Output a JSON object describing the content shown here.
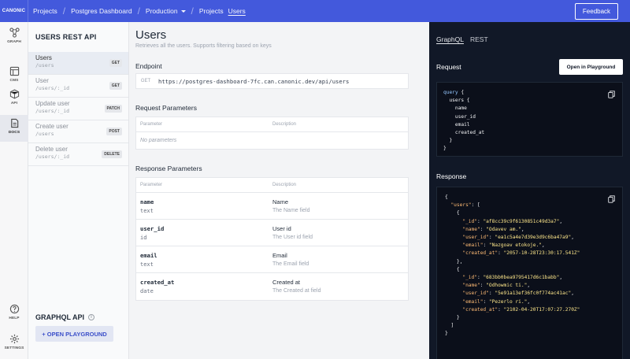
{
  "app": {
    "brand": "CANONIC"
  },
  "breadcrumb": [
    {
      "label": "Projects"
    },
    {
      "label": "Postgres Dashboard"
    },
    {
      "label": "Production"
    },
    {
      "label": "Projects"
    },
    {
      "label": "Users"
    }
  ],
  "header": {
    "feedback_label": "Feedback"
  },
  "rail": [
    {
      "label": "GRAPH",
      "icon": "graph-icon"
    },
    {
      "label": "CMS",
      "icon": "cms-icon"
    },
    {
      "label": "API",
      "icon": "api-cube-icon"
    },
    {
      "label": "DOCS",
      "icon": "docs-icon"
    },
    {
      "label": "HELP",
      "icon": "help-icon"
    },
    {
      "label": "SETTINGS",
      "icon": "gear-icon"
    }
  ],
  "sidebar": {
    "title": "USERS REST API",
    "items": [
      {
        "name": "Users",
        "path": "/users",
        "method": "GET"
      },
      {
        "name": "User",
        "path": "/users/:_id",
        "method": "GET"
      },
      {
        "name": "Update user",
        "path": "/users/:_id",
        "method": "PATCH"
      },
      {
        "name": "Create user",
        "path": "/users",
        "method": "POST"
      },
      {
        "name": "Delete user",
        "path": "/users/:_id",
        "method": "DELETE"
      }
    ],
    "graphql_title": "GRAPHQL API",
    "open_playground_label": "+ OPEN PLAYGROUND"
  },
  "main": {
    "title": "Users",
    "description": "Retrieves all the users. Supports filtering based on keys",
    "endpoint_heading": "Endpoint",
    "endpoint_method": "GET",
    "endpoint_url": "https://postgres-dashboard-7fc.can.canonic.dev/api/users",
    "request_heading": "Request Parameters",
    "col_parameter": "Parameter",
    "col_description": "Description",
    "no_params": "No parameters",
    "response_heading": "Response Parameters",
    "response_params": [
      {
        "name": "name",
        "type": "text",
        "title": "Name",
        "sub": "The Name field"
      },
      {
        "name": "user_id",
        "type": "id",
        "title": "User id",
        "sub": "The User id field"
      },
      {
        "name": "email",
        "type": "text",
        "title": "Email",
        "sub": "The Email field"
      },
      {
        "name": "created_at",
        "type": "date",
        "title": "Created at",
        "sub": "The Created at field"
      }
    ]
  },
  "right_panel": {
    "tabs": [
      "GraphQL",
      "REST"
    ],
    "request_heading": "Request",
    "open_playground_label": "Open in Playground",
    "query_lines": [
      "query {",
      "  users {",
      "    name",
      "    user_id",
      "    email",
      "    created_at",
      "  }",
      "}"
    ],
    "response_heading": "Response",
    "response_lines": [
      "{",
      "  \"users\": [",
      "    {",
      "      \"_id\": \"af8cc39c9f6130851c49d3a7\",",
      "      \"name\": \"Odavev am.\",",
      "      \"user_id\": \"ea1c5a4e7d39e3d9c6ba47a9\",",
      "      \"email\": \"Nazgoav etokoje.\",",
      "      \"created_at\": \"2057-10-28T23:30:17.541Z\"",
      "    },",
      "    {",
      "      \"_id\": \"683bb0bea9795417d6c1babb\",",
      "      \"name\": \"Odhowmic ti.\",",
      "      \"user_id\": \"5e91a13ef36fc0f774ac41ac\",",
      "      \"email\": \"Pezerlo ri.\",",
      "      \"created_at\": \"2102-04-20T17:07:27.270Z\"",
      "    }",
      "  ]",
      "}"
    ]
  }
}
